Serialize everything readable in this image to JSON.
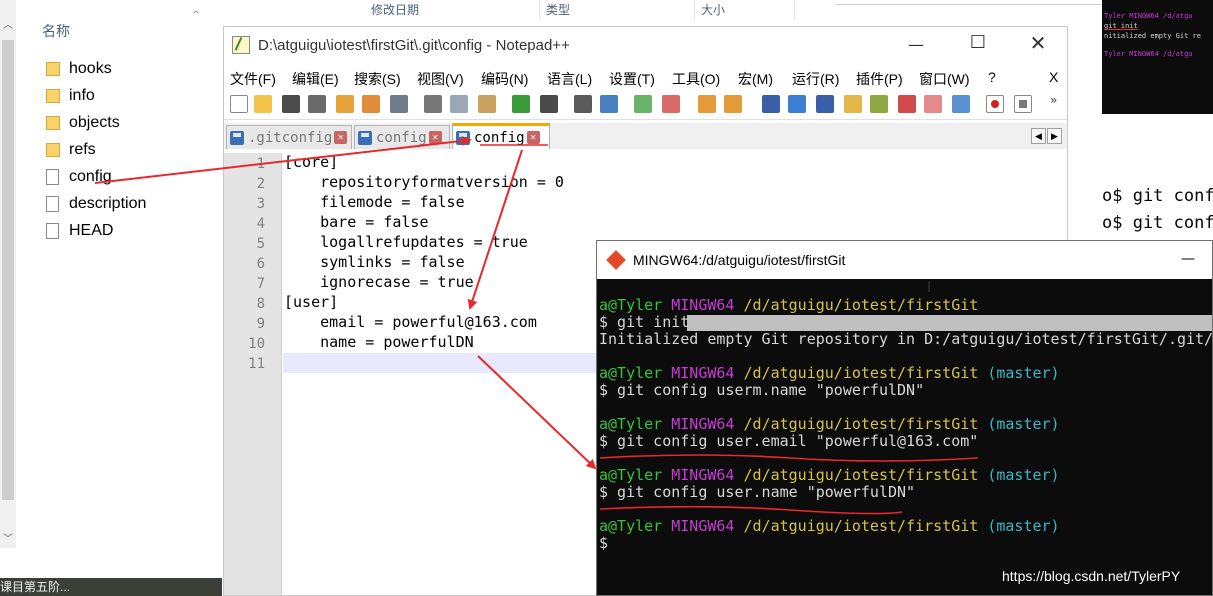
{
  "explorer": {
    "column_header": "名称",
    "items": [
      {
        "name": "hooks",
        "type": "folder"
      },
      {
        "name": "info",
        "type": "folder"
      },
      {
        "name": "objects",
        "type": "folder"
      },
      {
        "name": "refs",
        "type": "folder"
      },
      {
        "name": "config",
        "type": "file"
      },
      {
        "name": "description",
        "type": "file"
      },
      {
        "name": "HEAD",
        "type": "file"
      }
    ],
    "taskbar_snippet": "课目第五阶..."
  },
  "background_window": {
    "col_headers": [
      "修改日期",
      "类型",
      "大小"
    ],
    "cmd_lines": [
      "o$ git conf",
      "o$ git conf"
    ],
    "mini_terminal": [
      "Tyler MINGW64 /d/atgu",
      "git init",
      "nitialized empty Git re",
      "Tyler MINGW64 /d/atgu"
    ]
  },
  "notepad": {
    "title": "D:\\atguigu\\iotest\\firstGit\\.git\\config - Notepad++",
    "menu": [
      "文件(F)",
      "编辑(E)",
      "搜索(S)",
      "视图(V)",
      "编码(N)",
      "语言(L)",
      "设置(T)",
      "工具(O)",
      "宏(M)",
      "运行(R)",
      "插件(P)",
      "窗口(W)",
      "?"
    ],
    "close_doc": "X",
    "tabs": [
      {
        "label": ".gitconfig",
        "active": false
      },
      {
        "label": "config",
        "active": false
      },
      {
        "label": "config",
        "active": true
      }
    ],
    "lines": [
      {
        "num": "1",
        "text": "[core]"
      },
      {
        "num": "2",
        "text": "    repositoryformatversion = 0"
      },
      {
        "num": "3",
        "text": "    filemode = false"
      },
      {
        "num": "4",
        "text": "    bare = false"
      },
      {
        "num": "5",
        "text": "    logallrefupdates = true"
      },
      {
        "num": "6",
        "text": "    symlinks = false"
      },
      {
        "num": "7",
        "text": "    ignorecase = true"
      },
      {
        "num": "8",
        "text": "[user]"
      },
      {
        "num": "9",
        "text": "    email = powerful@163.com"
      },
      {
        "num": "10",
        "text": "    name = powerfulDN"
      },
      {
        "num": "11",
        "text": ""
      }
    ]
  },
  "terminal": {
    "title": "MINGW64:/d/atguigu/iotest/firstGit",
    "minimize": "—",
    "prompt_user": "a@Tyler",
    "prompt_host": "MINGW64",
    "prompt_path": "/d/atguigu/iotest/firstGit",
    "branch": "(master)",
    "commands": [
      "$ git init",
      "Initialized empty Git repository in D:/atguigu/iotest/firstGit/.git/",
      "$ git config userm.name \"powerfulDN\"",
      "$ git config user.email \"powerful@163.com\"",
      "$ git config user.name \"powerfulDN\"",
      "$"
    ]
  },
  "watermark": "https://blog.csdn.net/TylerPY",
  "colors": {
    "annotation_red": "#e8282b",
    "term_green": "#35c43a",
    "term_magenta": "#c73dd4",
    "term_yellow": "#d6c24a",
    "term_cyan": "#3db6c8",
    "tab_accent": "#f8a600"
  }
}
